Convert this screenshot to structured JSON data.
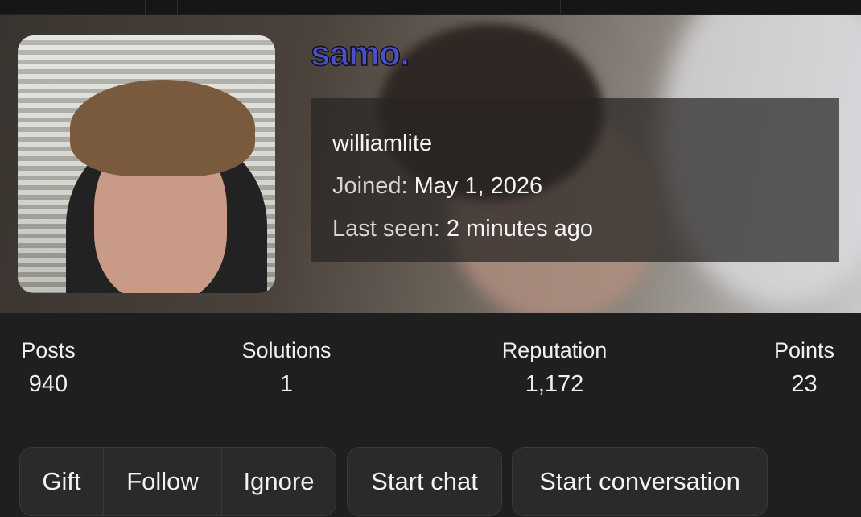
{
  "profile": {
    "display_name": "samo.",
    "username": "williamlite",
    "joined_label": "Joined:",
    "joined_value": "May 1, 2026",
    "last_seen_label": "Last seen:",
    "last_seen_value": "2 minutes ago",
    "name_color": "#4b4fc8"
  },
  "stats": [
    {
      "label": "Posts",
      "value": "940"
    },
    {
      "label": "Solutions",
      "value": "1"
    },
    {
      "label": "Reputation",
      "value": "1,172"
    },
    {
      "label": "Points",
      "value": "23"
    }
  ],
  "actions": {
    "gift": "Gift",
    "follow": "Follow",
    "ignore": "Ignore",
    "start_chat": "Start chat",
    "start_conversation": "Start conversation"
  }
}
